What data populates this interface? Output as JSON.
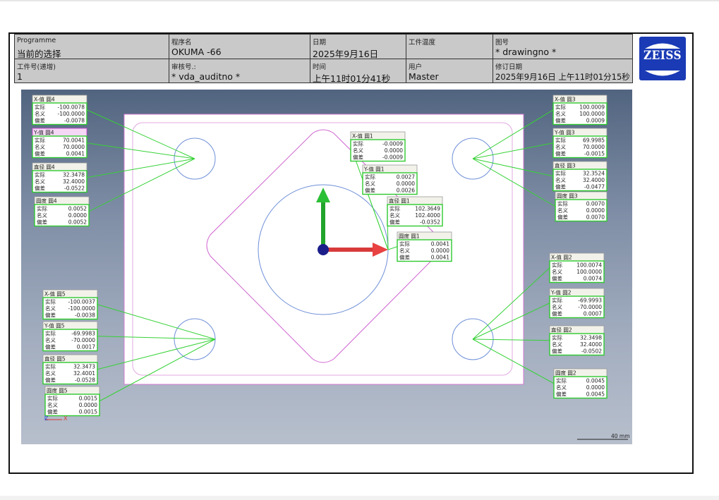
{
  "header": {
    "row1": [
      {
        "label": "Programme",
        "value": "当前的选择"
      },
      {
        "label": "程序名",
        "value": "OKUMA -66"
      },
      {
        "label": "日期",
        "value": "2025年9月16日"
      },
      {
        "label": "工件温度",
        "value": ""
      },
      {
        "label": "图号",
        "value": "* drawingno *"
      }
    ],
    "row2": [
      {
        "label": "工件号(递增)",
        "value": "1"
      },
      {
        "label": "审核号.:",
        "value": "* vda_auditno *"
      },
      {
        "label": "时间",
        "value": "上午11时01分41秒"
      },
      {
        "label": "用户",
        "value": "Master"
      },
      {
        "label": "修订日期",
        "value": "2025年9月16日    上午11时01分15秒"
      }
    ]
  },
  "logo": {
    "text": "ZEISS",
    "color": "#1a3bb5"
  },
  "view": {
    "scale_label": "40 mm",
    "axis_labels": {
      "z": "Z",
      "x": "X"
    },
    "row_labels": [
      "实际",
      "名义",
      "偏差"
    ]
  },
  "callouts": [
    {
      "title": "X-值 圆4",
      "values": [
        "-100.0078",
        "-100.0000",
        "-0.0078"
      ],
      "selected": false
    },
    {
      "title": "Y-值 圆4",
      "values": [
        "70.0041",
        "70.0000",
        "0.0041"
      ],
      "selected": true
    },
    {
      "title": "直径 圆4",
      "values": [
        "32.3478",
        "32.4000",
        "-0.0522"
      ],
      "selected": false
    },
    {
      "title": "圆度 圆4",
      "values": [
        "0.0052",
        "0.0000",
        "0.0052"
      ],
      "selected": false
    },
    {
      "title": "X-值 圆3",
      "values": [
        "100.0009",
        "100.0000",
        "0.0009"
      ],
      "selected": false
    },
    {
      "title": "Y-值 圆3",
      "values": [
        "69.9985",
        "70.0000",
        "-0.0015"
      ],
      "selected": false
    },
    {
      "title": "直径 圆3",
      "values": [
        "32.3524",
        "32.4000",
        "-0.0477"
      ],
      "selected": false
    },
    {
      "title": "圆度 圆3",
      "values": [
        "0.0070",
        "0.0000",
        "0.0070"
      ],
      "selected": false
    },
    {
      "title": "X-值 圆1",
      "values": [
        "-0.0009",
        "0.0000",
        "-0.0009"
      ],
      "selected": false
    },
    {
      "title": "Y-值 圆1",
      "values": [
        "0.0027",
        "0.0000",
        "0.0026"
      ],
      "selected": false
    },
    {
      "title": "直径 圆1",
      "values": [
        "102.3649",
        "102.4000",
        "-0.0352"
      ],
      "selected": false
    },
    {
      "title": "圆度 圆1",
      "values": [
        "0.0041",
        "0.0000",
        "0.0041"
      ],
      "selected": false
    },
    {
      "title": "X-值 圆2",
      "values": [
        "100.0074",
        "100.0000",
        "0.0074"
      ],
      "selected": false
    },
    {
      "title": "Y-值 圆2",
      "values": [
        "-69.9993",
        "-70.0000",
        "0.0007"
      ],
      "selected": false
    },
    {
      "title": "直径 圆2",
      "values": [
        "32.3498",
        "32.4000",
        "-0.0502"
      ],
      "selected": false
    },
    {
      "title": "圆度 圆2",
      "values": [
        "0.0045",
        "0.0000",
        "0.0045"
      ],
      "selected": false
    },
    {
      "title": "X-值 圆5",
      "values": [
        "-100.0037",
        "-100.0000",
        "-0.0038"
      ],
      "selected": false
    },
    {
      "title": "Y-值 圆5",
      "values": [
        "-69.9983",
        "-70.0000",
        "0.0017"
      ],
      "selected": false
    },
    {
      "title": "直径 圆5",
      "values": [
        "32.3473",
        "32.4001",
        "-0.0528"
      ],
      "selected": false
    },
    {
      "title": "圆度 圆5",
      "values": [
        "0.0015",
        "0.0000",
        "0.0015"
      ],
      "selected": false
    }
  ]
}
